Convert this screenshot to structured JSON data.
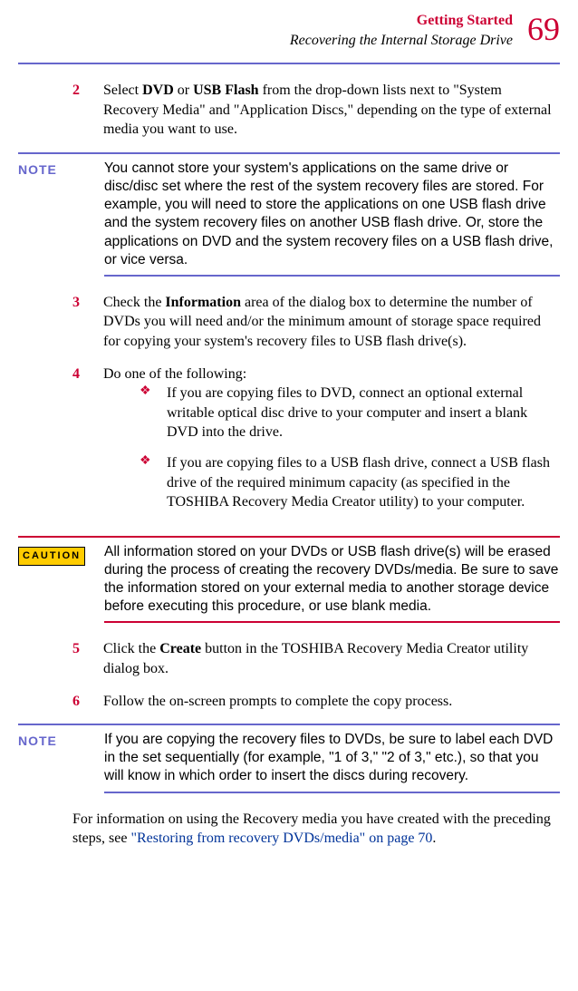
{
  "header": {
    "chapter": "Getting Started",
    "section": "Recovering the Internal Storage Drive",
    "page_number": "69"
  },
  "step2": {
    "num": "2",
    "text_before_bold1": "Select ",
    "bold1": "DVD",
    "mid1": " or ",
    "bold2": "USB Flash",
    "after": " from the drop-down lists next to \"System Recovery Media\" and \"Application Discs,\" depending on the type of external media you want to use."
  },
  "note1": {
    "label": "NOTE",
    "text": "You cannot store your system's applications on the same drive or disc/disc set where the rest of the system recovery files are stored. For example, you will need to store the applications on one USB flash drive and the system recovery files on another USB flash drive. Or, store the applications on DVD and the system recovery files on a USB flash drive, or vice versa."
  },
  "step3": {
    "num": "3",
    "before": "Check the ",
    "bold": "Information",
    "after": " area of the dialog box to determine the number of DVDs you will need and/or the minimum amount of storage space required for copying your system's recovery files to USB flash drive(s)."
  },
  "step4": {
    "num": "4",
    "text": "Do one of the following:"
  },
  "bullet1": "If you are copying files to DVD, connect an optional external writable optical disc drive to your computer and insert a blank DVD into the drive.",
  "bullet2": "If you are copying files to a USB flash drive, connect a USB flash drive of the required minimum capacity (as specified in the TOSHIBA Recovery Media Creator utility) to your computer.",
  "caution": {
    "label": "CAUTION",
    "text": "All information stored on your DVDs or USB flash drive(s) will be erased during the process of creating the recovery DVDs/media. Be sure to save the information stored on your external media to another storage device before executing this procedure, or use blank media."
  },
  "step5": {
    "num": "5",
    "before": "Click the ",
    "bold": "Create",
    "after": " button in the TOSHIBA Recovery Media Creator utility dialog box."
  },
  "step6": {
    "num": "6",
    "text": "Follow the on-screen prompts to complete the copy process."
  },
  "note2": {
    "label": "NOTE",
    "text": "If you are copying the recovery files to DVDs, be sure to label each DVD in the set sequentially (for example, \"1 of 3,\" \"2 of 3,\" etc.), so that you will know in which order to insert the discs during recovery."
  },
  "trailing": {
    "before": "For information on using the Recovery media you have created with the preceding steps, see ",
    "link": "\"Restoring from recovery DVDs/media\" on page 70",
    "after": "."
  }
}
